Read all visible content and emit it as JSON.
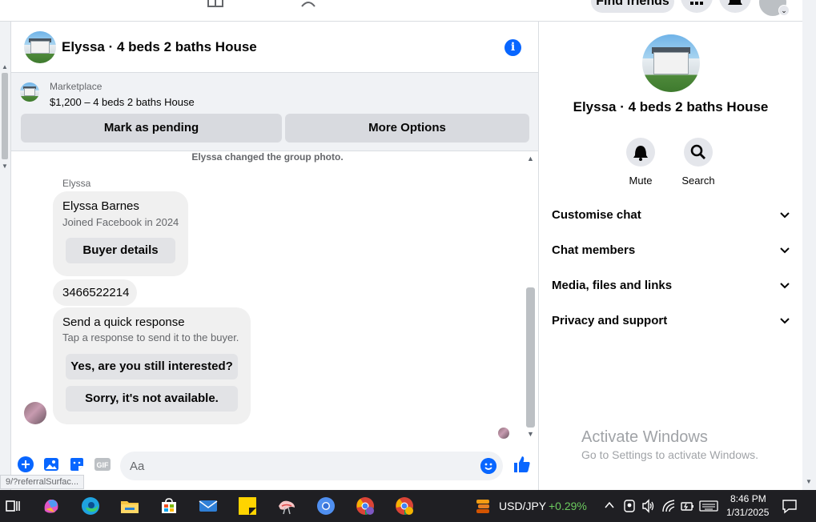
{
  "topbar": {
    "find_friends_label": "Find friends"
  },
  "chat": {
    "title": "Elyssa · 4 beds 2 baths House",
    "marketplace_label": "Marketplace",
    "listing": "$1,200 – 4 beds 2 baths House",
    "mark_pending_label": "Mark as pending",
    "more_options_label": "More Options",
    "system_message": "Elyssa changed the group photo.",
    "sender_name": "Elyssa",
    "profile_card": {
      "name": "Elyssa Barnes",
      "joined": "Joined Facebook in 2024",
      "button_label": "Buyer details"
    },
    "phone_message": "3466522214",
    "quick_response": {
      "title": "Send a quick response",
      "subtitle": "Tap a response to send it to the buyer.",
      "options": [
        "Yes, are you still interested?",
        "Sorry, it's not available."
      ]
    },
    "composer_placeholder": "Aa",
    "status_url": "9/?referralSurfac..."
  },
  "info_panel": {
    "title": "Elyssa · 4 beds 2 baths House",
    "actions": [
      {
        "label": "Mute",
        "icon": "bell-icon"
      },
      {
        "label": "Search",
        "icon": "search-icon"
      }
    ],
    "sections": [
      "Customise chat",
      "Chat members",
      "Media, files and links",
      "Privacy and support"
    ]
  },
  "watermark": {
    "line1": "Activate Windows",
    "line2": "Go to Settings to activate Windows."
  },
  "taskbar": {
    "ticker_symbol": "USD/JPY",
    "ticker_change": "+0.29%",
    "time": "8:46 PM",
    "date": "1/31/2025"
  },
  "colors": {
    "accent": "#0866ff",
    "ticker_positive": "#6ccb5f"
  }
}
